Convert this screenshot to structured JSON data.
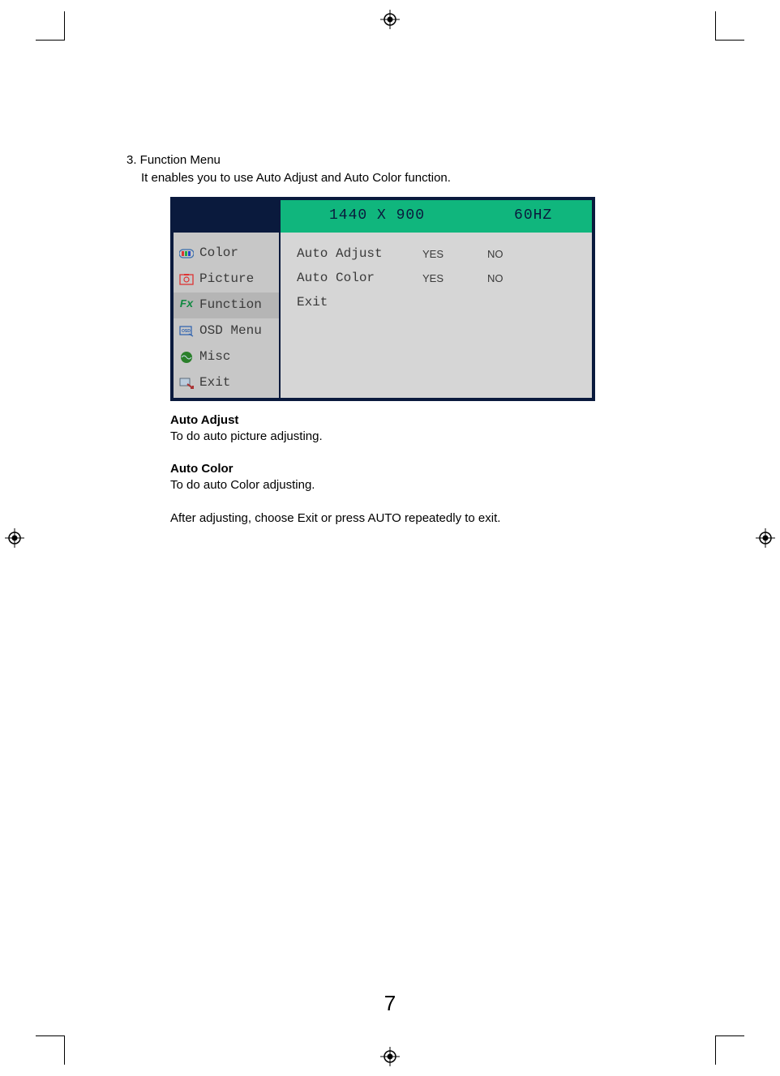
{
  "section": {
    "number_title": "3. Function Menu",
    "intro": "It enables you to use Auto Adjust and Auto Color function."
  },
  "osd": {
    "resolution": "1440 X 900",
    "refresh": "60HZ",
    "sidebar": {
      "color": {
        "label": "Color",
        "icon_name": "color-icon"
      },
      "picture": {
        "label": "Picture",
        "icon_name": "picture-icon"
      },
      "function": {
        "label": "Function",
        "icon_name": "function-icon"
      },
      "osdmenu": {
        "label": "OSD Menu",
        "icon_name": "osd-menu-icon"
      },
      "misc": {
        "label": "Misc",
        "icon_name": "misc-icon"
      },
      "exit": {
        "label": "Exit",
        "icon_name": "exit-icon"
      }
    },
    "options": {
      "auto_adjust": {
        "label": "Auto Adjust",
        "yes": "YES",
        "no": "NO"
      },
      "auto_color": {
        "label": "Auto Color",
        "yes": "YES",
        "no": "NO"
      },
      "exit": {
        "label": "Exit"
      }
    }
  },
  "descriptions": {
    "auto_adjust_term": "Auto Adjust",
    "auto_adjust_body": "To do auto picture adjusting.",
    "auto_color_term": "Auto Color",
    "auto_color_body": "To do auto Color adjusting.",
    "footer": "After adjusting, choose Exit or press AUTO repeatedly to exit."
  },
  "page_number": "7"
}
